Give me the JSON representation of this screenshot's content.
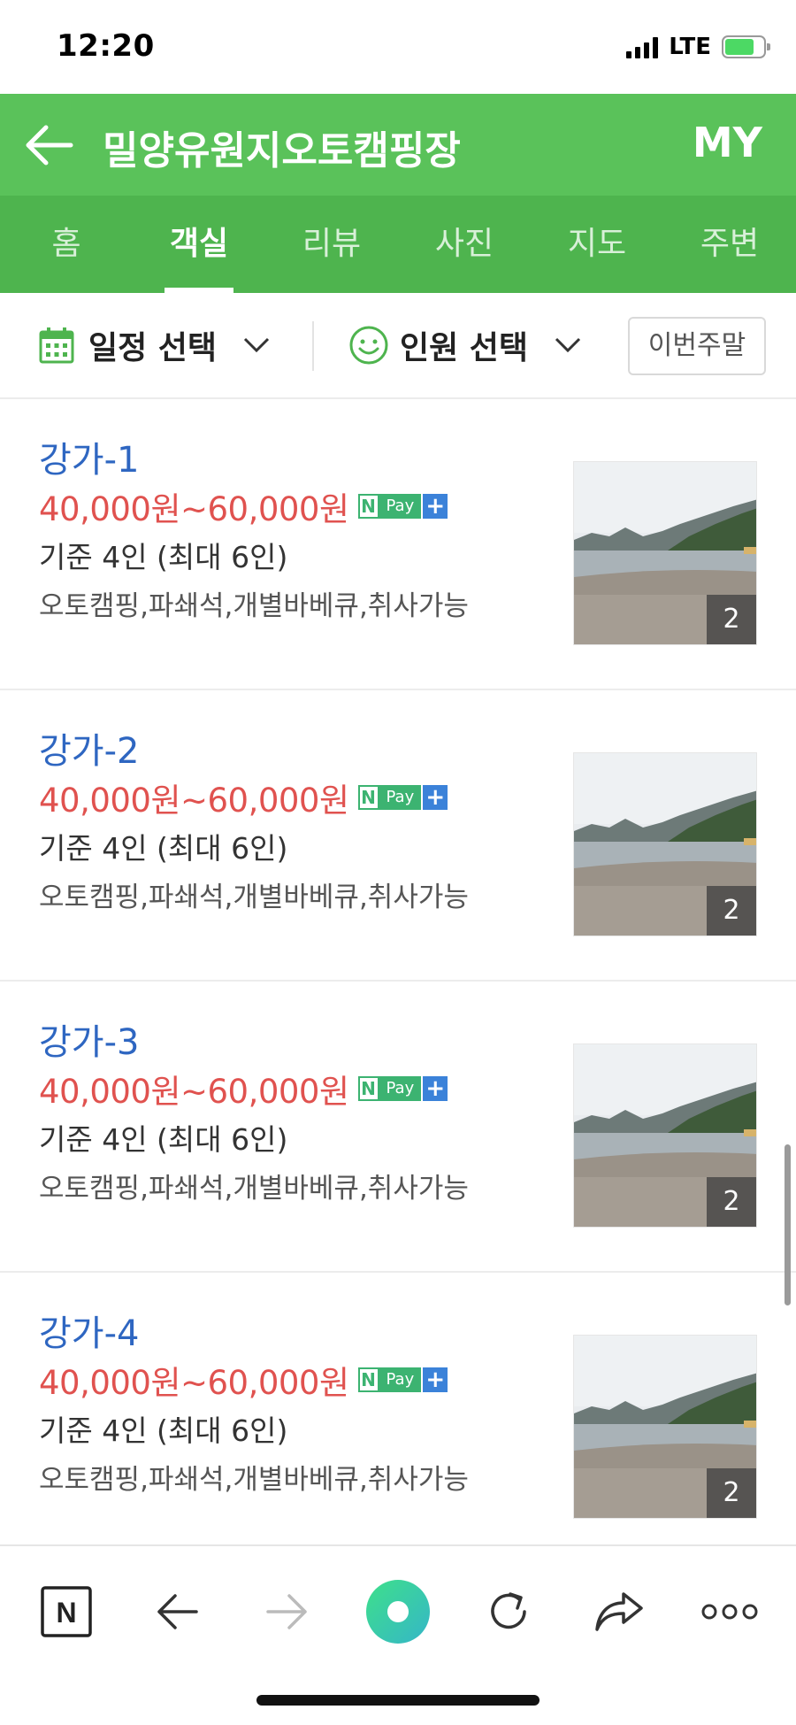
{
  "status_bar": {
    "time": "12:20",
    "network": "LTE"
  },
  "header": {
    "title": "밀양유원지오토캠핑장",
    "my_label": "MY"
  },
  "tabs": [
    {
      "label": "홈",
      "active": false
    },
    {
      "label": "객실",
      "active": true
    },
    {
      "label": "리뷰",
      "active": false
    },
    {
      "label": "사진",
      "active": false
    },
    {
      "label": "지도",
      "active": false
    },
    {
      "label": "주변",
      "active": false
    }
  ],
  "filters": {
    "date_label": "일정 선택",
    "people_label": "인원 선택",
    "weekend_label": "이번주말"
  },
  "rooms": [
    {
      "name": "강가-1",
      "price": "40,000원~60,000원",
      "capacity": "기준 4인 (최대 6인)",
      "tags": "오토캠핑,파쇄석,개별바베큐,취사가능",
      "photo_count": "2"
    },
    {
      "name": "강가-2",
      "price": "40,000원~60,000원",
      "capacity": "기준 4인 (최대 6인)",
      "tags": "오토캠핑,파쇄석,개별바베큐,취사가능",
      "photo_count": "2"
    },
    {
      "name": "강가-3",
      "price": "40,000원~60,000원",
      "capacity": "기준 4인 (최대 6인)",
      "tags": "오토캠핑,파쇄석,개별바베큐,취사가능",
      "photo_count": "2"
    },
    {
      "name": "강가-4",
      "price": "40,000원~60,000원",
      "capacity": "기준 4인 (최대 6인)",
      "tags": "오토캠핑,파쇄석,개별바베큐,취사가능",
      "photo_count": "2"
    }
  ],
  "npay": {
    "n": "N",
    "pay": "Pay",
    "plus": "+"
  },
  "colors": {
    "header_green": "#5ac25a",
    "tab_green": "#4eb44e",
    "room_name_blue": "#2e66c1",
    "price_red": "#e0524f",
    "npay_green": "#3cb371",
    "npay_blue": "#3b82d9"
  },
  "toolbar_icons": [
    "naver-n-icon",
    "back-arrow-icon",
    "forward-arrow-icon",
    "green-dot-icon",
    "refresh-icon",
    "share-icon",
    "more-icon"
  ]
}
